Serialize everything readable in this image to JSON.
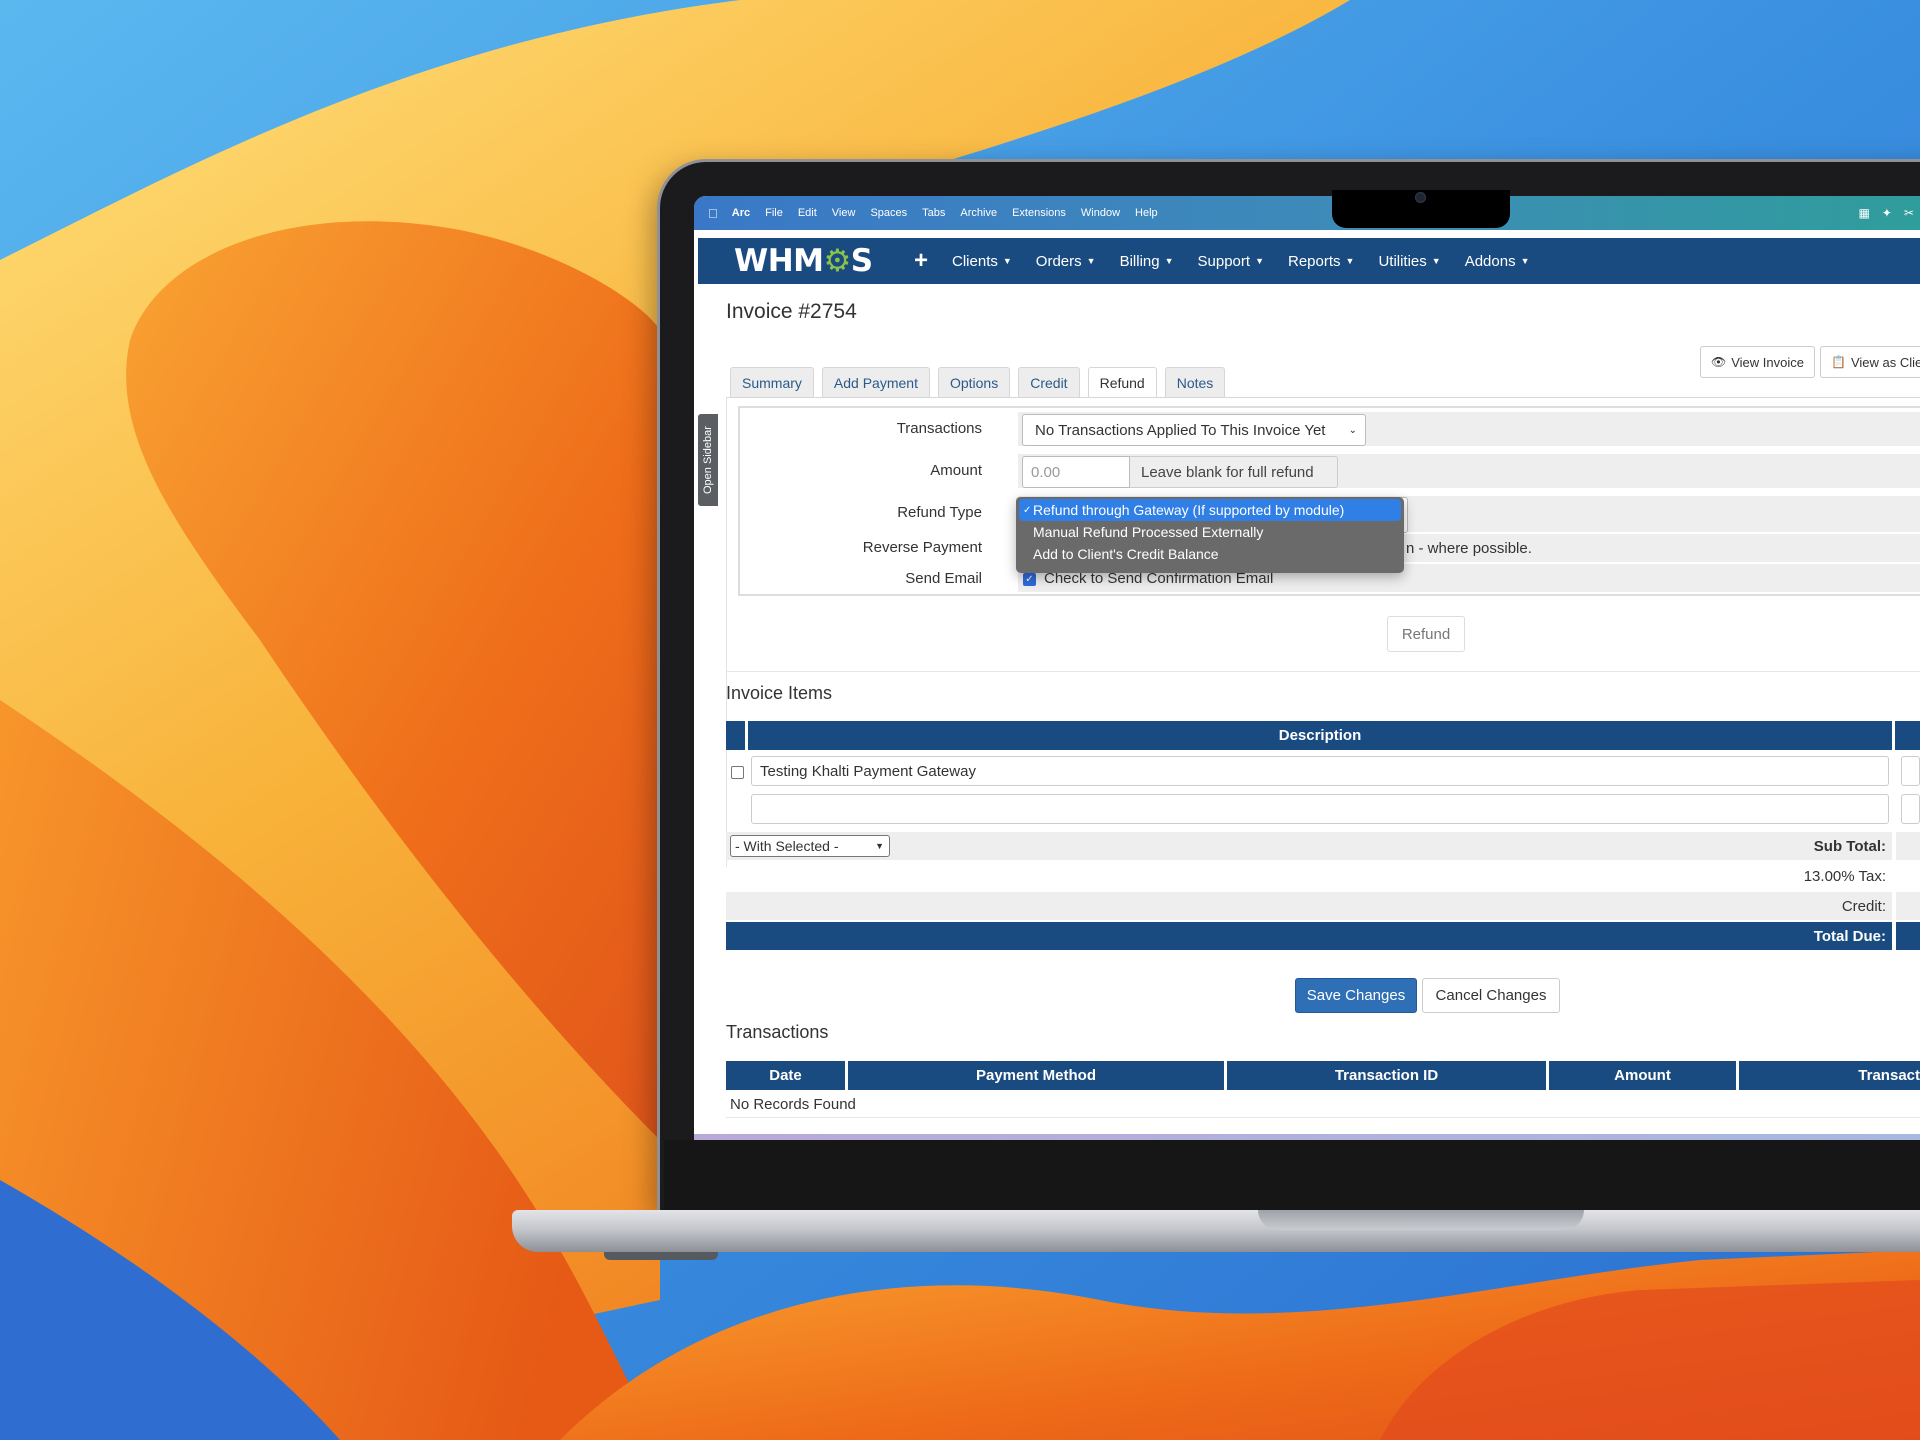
{
  "menubar": {
    "app": "Arc",
    "items": [
      "File",
      "Edit",
      "View",
      "Spaces",
      "Tabs",
      "Archive",
      "Extensions",
      "Window",
      "Help"
    ],
    "icons": [
      "apple-icon",
      "grid-icon",
      "bird-icon",
      "scissors-icon"
    ]
  },
  "nav": {
    "logo": "WHMCS",
    "logo_parts": [
      "WHM",
      "⚙",
      "S"
    ],
    "add_symbol": "+",
    "items": [
      "Clients",
      "Orders",
      "Billing",
      "Support",
      "Reports",
      "Utilities",
      "Addons"
    ]
  },
  "page": {
    "title": "Invoice #2754",
    "sidebar_toggle": "Open Sidebar",
    "view_invoice": "View Invoice",
    "view_as_client": "View as Clien"
  },
  "tabs": [
    "Summary",
    "Add Payment",
    "Options",
    "Credit",
    "Refund",
    "Notes"
  ],
  "active_tab": "Refund",
  "refund_form": {
    "transactions_label": "Transactions",
    "transactions_value": "No Transactions Applied To This Invoice Yet",
    "amount_label": "Amount",
    "amount_placeholder": "0.00",
    "amount_hint": "Leave blank for full refund",
    "refund_type_label": "Refund Type",
    "refund_type_options": [
      "Refund through Gateway (If supported by module)",
      "Manual Refund Processed Externally",
      "Add to Client's Credit Balance"
    ],
    "refund_type_selected": "Refund through Gateway (If supported by module)",
    "reverse_payment_label": "Reverse Payment",
    "reverse_payment_text": "n - where possible.",
    "send_email_label": "Send Email",
    "send_email_checked": true,
    "send_email_text": "Check to Send Confirmation Email",
    "refund_button": "Refund"
  },
  "invoice_items": {
    "heading": "Invoice Items",
    "column": "Description",
    "rows": [
      "Testing Khalti Payment Gateway",
      ""
    ],
    "with_selected": "- With Selected -",
    "subtotal_label": "Sub Total:",
    "tax_label": "13.00% Tax:",
    "credit_label": "Credit:",
    "total_due_label": "Total Due:"
  },
  "actions": {
    "save": "Save Changes",
    "cancel": "Cancel Changes"
  },
  "transactions": {
    "heading": "Transactions",
    "columns": [
      "Date",
      "Payment Method",
      "Transaction ID",
      "Amount",
      "Transact"
    ],
    "empty": "No Records Found"
  },
  "colors": {
    "nav_blue": "#1a4b80",
    "dropdown_highlight": "#2f7fe6",
    "save_button": "#2f6fb5",
    "logo_gear": "#8bc34a"
  }
}
